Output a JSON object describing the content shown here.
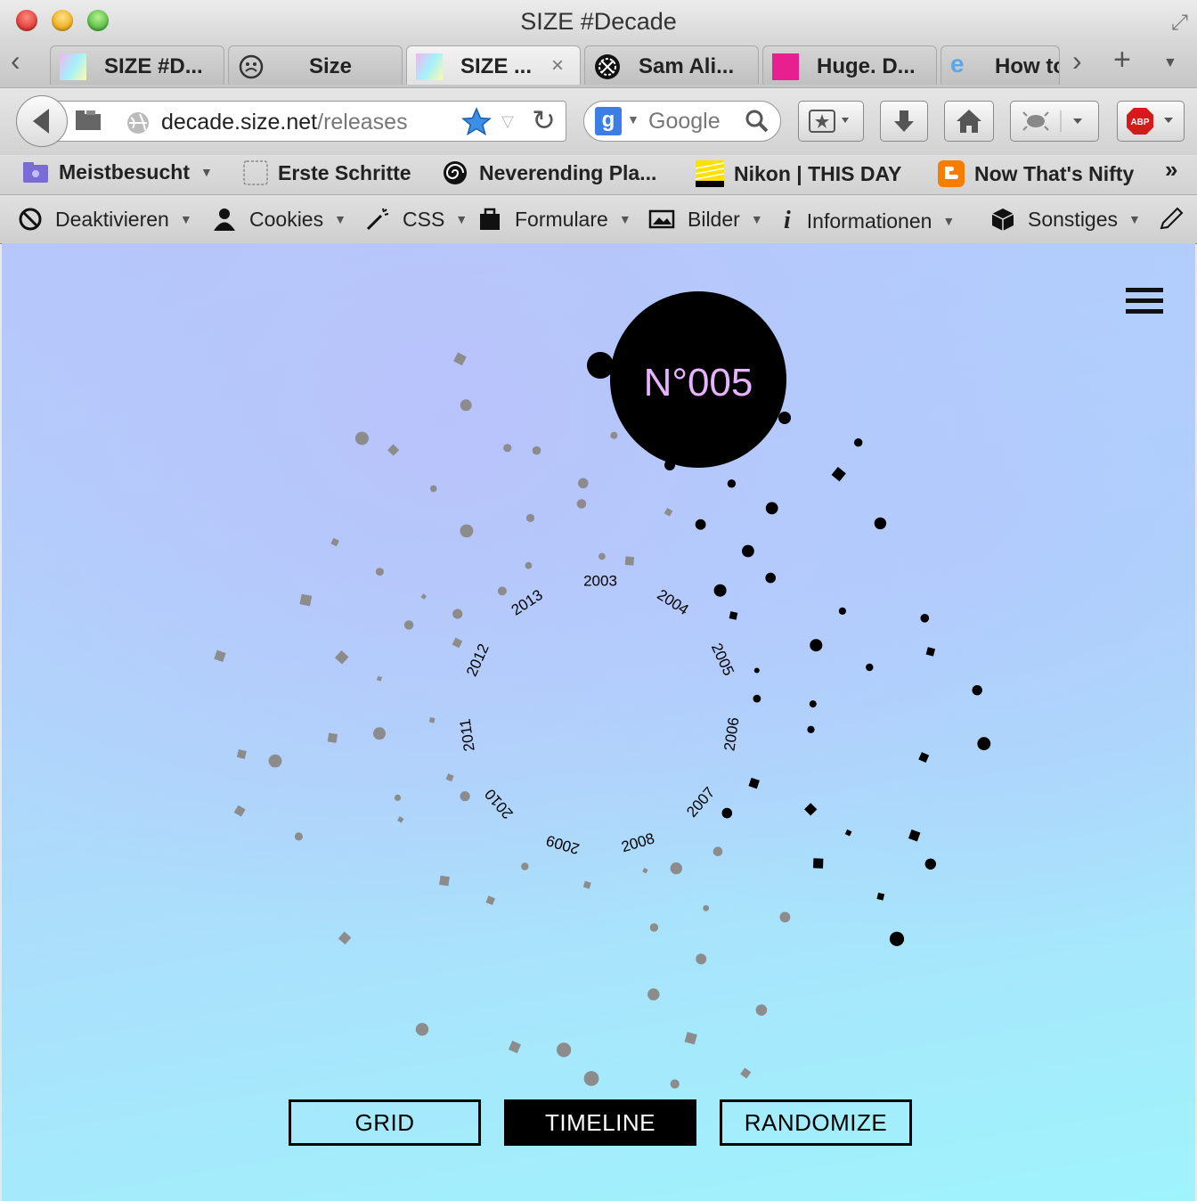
{
  "window": {
    "title": "SIZE #Decade"
  },
  "tabs": [
    {
      "label": "SIZE #D...",
      "icon": "size-gradient-icon",
      "active": false
    },
    {
      "label": "Size",
      "icon": "size-logo-icon",
      "active": false
    },
    {
      "label": "SIZE ...",
      "icon": "size-gradient-icon",
      "active": true,
      "close": "×"
    },
    {
      "label": "Sam Ali...",
      "icon": "sam-ali-icon",
      "active": false
    },
    {
      "label": "Huge. D...",
      "icon": "huge-icon",
      "active": false
    },
    {
      "label": "How to",
      "icon": "how-to-icon",
      "active": false
    }
  ],
  "navbar": {
    "url_domain": "decade.size.net",
    "url_path": "/releases",
    "search_placeholder": "Google"
  },
  "bookmarks": [
    {
      "label": "Meistbesucht",
      "icon": "folder-icon"
    },
    {
      "label": "Erste Schritte",
      "icon": "dashed-page-icon"
    },
    {
      "label": "Neverending Pla...",
      "icon": "spiral-icon"
    },
    {
      "label": "Nikon | THIS DAY",
      "icon": "nikon-icon"
    },
    {
      "label": "Now That's Nifty",
      "icon": "blogger-icon"
    }
  ],
  "webdev": [
    {
      "label": "Deaktivieren",
      "icon": "prohibit-icon"
    },
    {
      "label": "Cookies",
      "icon": "person-icon"
    },
    {
      "label": "CSS",
      "icon": "wand-icon"
    },
    {
      "label": "Formulare",
      "icon": "briefcase-icon"
    },
    {
      "label": "Bilder",
      "icon": "image-icon"
    },
    {
      "label": "Informationen",
      "icon": "info-icon"
    },
    {
      "label": "Sonstiges",
      "icon": "cube-icon"
    }
  ],
  "timeline": {
    "selected_release": "N°005",
    "years": [
      "2003",
      "2004",
      "2005",
      "2006",
      "2007",
      "2008",
      "2009",
      "2010",
      "2011",
      "2012",
      "2013"
    ],
    "active_color": "#000000",
    "inactive_color": "#8c8c8c"
  },
  "view_buttons": [
    {
      "label": "GRID",
      "active": false
    },
    {
      "label": "TIMELINE",
      "active": true
    },
    {
      "label": "RANDOMIZE",
      "active": false
    }
  ],
  "colors": {
    "bg_top": "#b6c8fb",
    "bg_bottom": "#9ff4fc",
    "release_label": "#e6b3ff"
  }
}
